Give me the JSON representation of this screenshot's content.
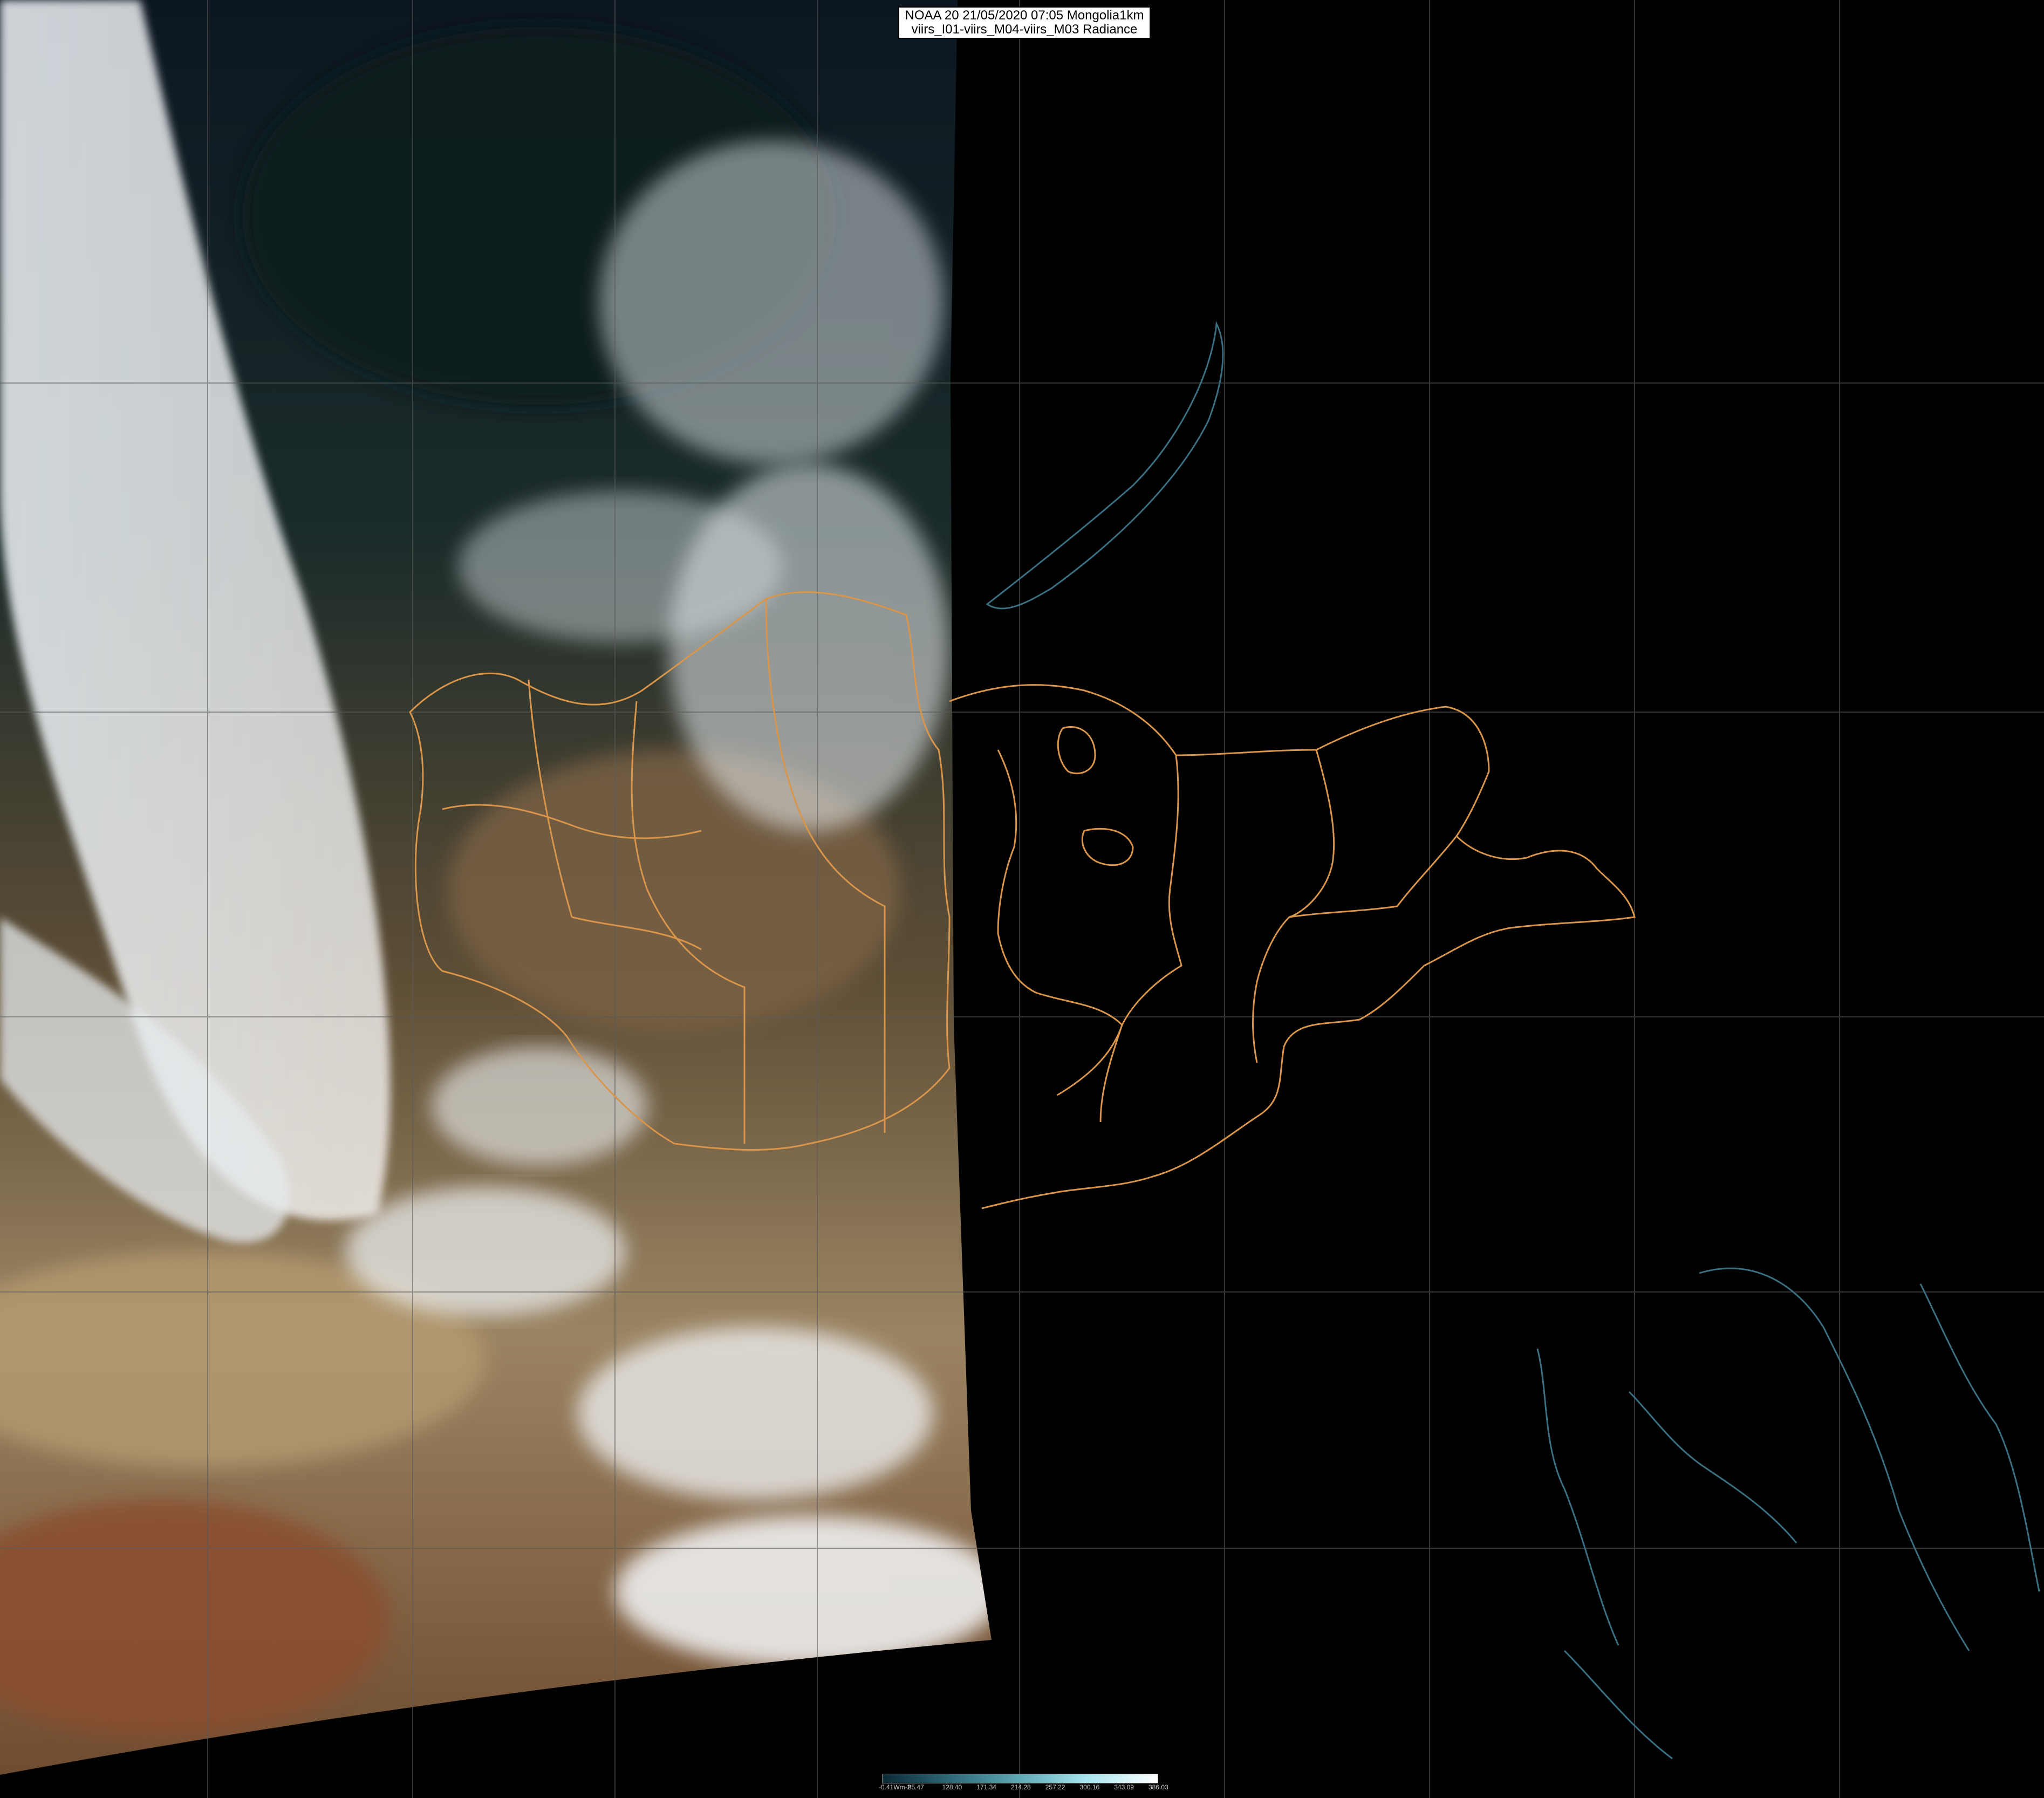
{
  "header": {
    "line1": "NOAA 20 21/05/2020 07:05 Mongolia1km",
    "line2": "viirs_I01-viirs_M04-viirs_M03 Radiance"
  },
  "colorbar": {
    "ticks": [
      "-0.41Wm-2",
      "85.47",
      "128.40",
      "171.34",
      "214.28",
      "257.22",
      "300.16",
      "343.09",
      "386.03"
    ],
    "colors": [
      "#0a2a35",
      "#2f6a78",
      "#5fa9b5",
      "#a9e7ef",
      "#ffffff"
    ]
  },
  "map": {
    "background": "#000000",
    "grid_color": "#5a5a5a",
    "province_border_color": "#d9954a",
    "coastline_color": "#3b6f82"
  }
}
